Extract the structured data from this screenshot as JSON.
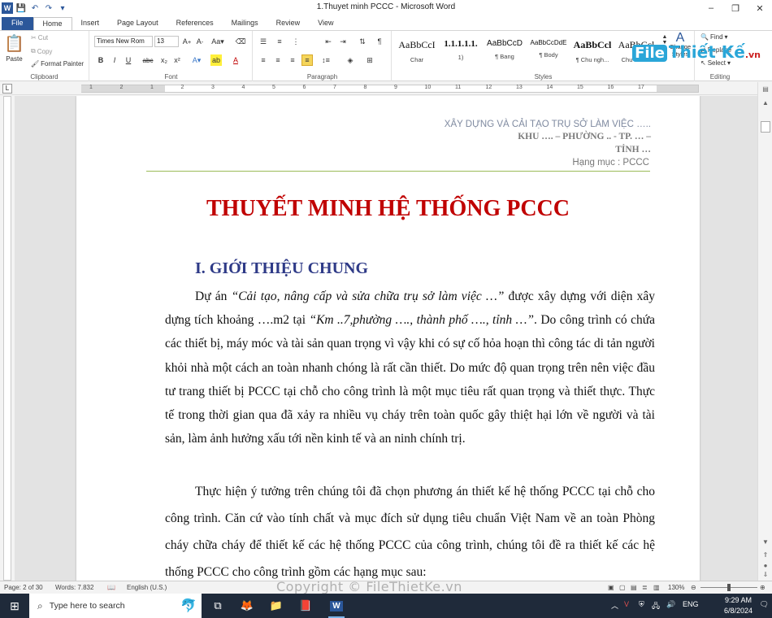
{
  "window": {
    "title": "1.Thuyet minh PCCC  -  Microsoft Word",
    "controls": {
      "minimize": "–",
      "restore": "❐",
      "close": "✕"
    }
  },
  "ribbon_tabs": [
    "File",
    "Home",
    "Insert",
    "Page Layout",
    "References",
    "Mailings",
    "Review",
    "View"
  ],
  "ribbon": {
    "clipboard": {
      "paste": "Paste",
      "cut": "Cut",
      "copy": "Copy",
      "format_painter": "Format Painter",
      "label": "Clipboard"
    },
    "font": {
      "name": "Times New Rom",
      "size": "13",
      "label": "Font",
      "buttons": [
        "B",
        "I",
        "U",
        "abc",
        "x₂",
        "x²"
      ]
    },
    "paragraph": {
      "label": "Paragraph"
    },
    "styles": {
      "label": "Styles",
      "items": [
        {
          "sample": "AaBbCcI",
          "name": "Char"
        },
        {
          "sample": "1.1.1.1.1.",
          "name": "1)"
        },
        {
          "sample": "AaBbCcD",
          "name": "¶ Bang"
        },
        {
          "sample": "AaBbCcDdE",
          "name": "¶ Body"
        },
        {
          "sample": "AaBbCcl",
          "name": "¶ Chu ngh..."
        },
        {
          "sample": "AaBbCcl",
          "name": "Chu thuo..."
        }
      ],
      "change_styles": "Change Styles"
    },
    "editing": {
      "find": "Find",
      "replace": "Replace",
      "select": "Select",
      "label": "Editing"
    }
  },
  "brand_logo": {
    "prefix": "File",
    "main": "Thiết Kế",
    "suffix": ".vn"
  },
  "ruler_numbers": [
    "1",
    "2",
    "1",
    "2",
    "3",
    "4",
    "5",
    "6",
    "7",
    "8",
    "9",
    "10",
    "11",
    "12",
    "13",
    "14",
    "15",
    "16",
    "17"
  ],
  "document": {
    "header": {
      "line1": "XÂY DỰNG VÀ CẢI TẠO TRỤ SỞ LÀM VIỆC …..",
      "line2": "KHU …. – PHƯỜNG .. - TP. … –",
      "line3": "TỈNH …",
      "line4": "Hạng mục : PCCC"
    },
    "title": "THUYẾT MINH HỆ THỐNG PCCC",
    "section_heading": "I. GIỚI THIỆU CHUNG",
    "paragraph1": {
      "t1": "Dự án ",
      "t2": "“Cải tạo, nâng cấp và sửa chữa trụ sở làm việc …”",
      "t3": " được xây dựng với diện xây dựng tích khoảng ….m2 tại ",
      "t4": "“Km ..7,phường …., thành phố …., tỉnh …”",
      "t5": ". Do công trình có chứa các thiết bị, máy móc và tài sản quan trọng vì vậy khi có sự cố hỏa hoạn thì công tác di tản người khỏi nhà một cách an toàn nhanh chóng là rất cần thiết. Do mức độ quan trọng trên nên việc đầu tư trang thiết bị PCCC tại chỗ cho công trình là một mục tiêu rất quan trọng và thiết thực. Thực tế trong thời gian qua đã xảy ra nhiều vụ cháy trên toàn quốc gây thiệt hại lớn về người và tài sản, làm ảnh hưởng xấu tới nền kinh tế và an ninh chính trị."
    },
    "paragraph2": "Thực hiện ý tưởng trên chúng tôi đã chọn phương án thiết kế hệ thống PCCC tại chỗ cho công trình. Căn cứ vào tính chất và mục đích sử dụng  tiêu chuẩn Việt Nam về an toàn Phòng cháy chữa cháy để thiết kế các hệ thống PCCC của công trình,  chúng tôi đề ra thiết kế các hệ thống PCCC cho công trình gồm các hạng mục sau:"
  },
  "status": {
    "page": "Page: 2 of 30",
    "words": "Words: 7.832",
    "language": "English (U.S.)",
    "zoom": "130%",
    "zoom_level": 0.5,
    "watermark": "Copyright © FileThietKe.vn"
  },
  "taskbar": {
    "search_placeholder": "Type here to search",
    "lang": "ENG",
    "time": "9:29 AM",
    "date": "6/8/2024"
  },
  "colors": {
    "title_red": "#c00000",
    "heading_blue": "#2e3a87",
    "word_blue": "#2b579a",
    "header_rule_green": "#9bbb59"
  }
}
